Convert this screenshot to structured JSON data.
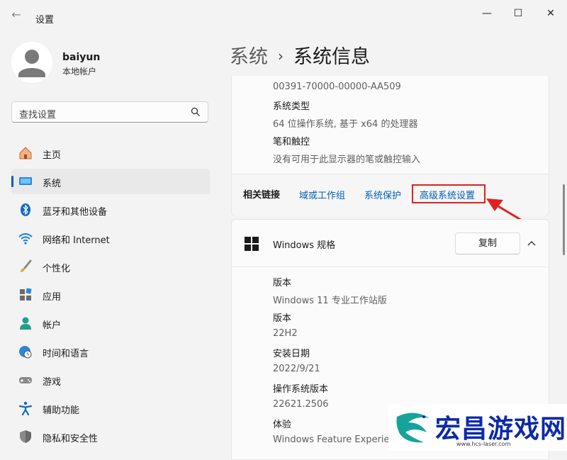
{
  "window": {
    "title": "设置",
    "minimize": "—",
    "maximize": "☐",
    "close": "✕"
  },
  "user": {
    "name": "baiyun",
    "account_type": "本地帐户"
  },
  "search": {
    "placeholder": "查找设置"
  },
  "nav": [
    {
      "label": "主页",
      "icon": "home-icon"
    },
    {
      "label": "系统",
      "icon": "system-icon",
      "active": true
    },
    {
      "label": "蓝牙和其他设备",
      "icon": "bluetooth-icon"
    },
    {
      "label": "网络和 Internet",
      "icon": "wifi-icon"
    },
    {
      "label": "个性化",
      "icon": "brush-icon"
    },
    {
      "label": "应用",
      "icon": "apps-icon"
    },
    {
      "label": "帐户",
      "icon": "account-icon"
    },
    {
      "label": "时间和语言",
      "icon": "clock-globe-icon"
    },
    {
      "label": "游戏",
      "icon": "gamepad-icon"
    },
    {
      "label": "辅助功能",
      "icon": "accessibility-icon"
    },
    {
      "label": "隐私和安全性",
      "icon": "shield-icon"
    }
  ],
  "breadcrumb": {
    "parent": "系统",
    "separator": "›",
    "current": "系统信息"
  },
  "device_specs": {
    "product_id": "00391-70000-00000-AA509",
    "system_type_label": "系统类型",
    "system_type_value": "64 位操作系统, 基于 x64 的处理器",
    "pen_touch_label": "笔和触控",
    "pen_touch_value": "没有可用于此显示器的笔或触控输入"
  },
  "related_links": {
    "title": "相关链接",
    "links": [
      "域或工作组",
      "系统保护",
      "高级系统设置"
    ]
  },
  "windows_specs": {
    "title": "Windows 规格",
    "copy_button": "复制",
    "rows": [
      {
        "label": "版本",
        "value": "Windows 11 专业工作站版"
      },
      {
        "label": "版本",
        "value": "22H2"
      },
      {
        "label": "安装日期",
        "value": "2022/9/21"
      },
      {
        "label": "操作系统版本",
        "value": "22621.2506"
      },
      {
        "label": "体验",
        "value": "Windows Feature Experien"
      }
    ]
  },
  "watermark": {
    "text": "宏昌游戏网",
    "url": "www.hcs-laser.com"
  },
  "colors": {
    "accent": "#005fb8",
    "highlight": "#e02020",
    "watermark": "#0d2aa8"
  }
}
